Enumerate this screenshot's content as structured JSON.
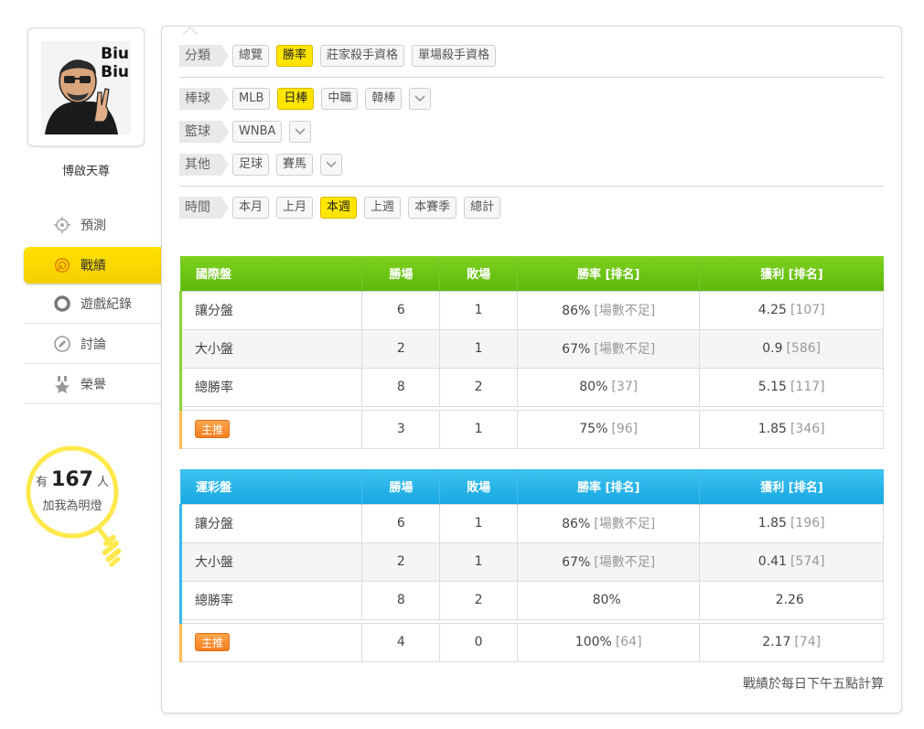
{
  "profile": {
    "avatar_caption": [
      "Biu",
      "Biu"
    ],
    "username": "博啟天尊"
  },
  "side_nav": [
    {
      "label": "預測",
      "icon": "crosshair-icon"
    },
    {
      "label": "戰績",
      "icon": "target-icon",
      "active": true
    },
    {
      "label": "遊戲紀錄",
      "icon": "circle-icon"
    },
    {
      "label": "討論",
      "icon": "pencil-bubble-icon"
    },
    {
      "label": "榮譽",
      "icon": "medal-star-icon"
    }
  ],
  "fans": {
    "prefix": "有",
    "count": "167",
    "suffix": "人",
    "line2": "加我為明燈"
  },
  "filters": {
    "category": {
      "label": "分類",
      "options": [
        "總覽",
        "勝率",
        "莊家殺手資格",
        "單場殺手資格"
      ],
      "selected": "勝率"
    },
    "baseball": {
      "label": "棒球",
      "options": [
        "MLB",
        "日棒",
        "中職",
        "韓棒"
      ],
      "selected": "日棒"
    },
    "basketball": {
      "label": "籃球",
      "options": [
        "WNBA"
      ],
      "selected": ""
    },
    "other": {
      "label": "其他",
      "options": [
        "足球",
        "賽馬"
      ],
      "selected": ""
    },
    "time": {
      "label": "時間",
      "options": [
        "本月",
        "上月",
        "本週",
        "上週",
        "本賽季",
        "總計"
      ],
      "selected": "本週"
    }
  },
  "international": {
    "headers": [
      "國際盤",
      "勝場",
      "敗場",
      "勝率 [排名]",
      "獲利 [排名]"
    ],
    "rows": [
      {
        "name": "讓分盤",
        "win": "6",
        "lose": "1",
        "rate": "86%",
        "rate_rank": "[場數不足]",
        "profit": "4.25",
        "profit_rank": "[107]"
      },
      {
        "name": "大小盤",
        "win": "2",
        "lose": "1",
        "rate": "67%",
        "rate_rank": "[場數不足]",
        "profit": "0.9",
        "profit_rank": "[586]"
      },
      {
        "name": "總勝率",
        "win": "8",
        "lose": "2",
        "rate": "80%",
        "rate_rank": "[37]",
        "profit": "5.15",
        "profit_rank": "[117]"
      }
    ],
    "tip": {
      "name": "主推",
      "win": "3",
      "lose": "1",
      "rate": "75%",
      "rate_rank": "[96]",
      "profit": "1.85",
      "profit_rank": "[346]"
    }
  },
  "lottery": {
    "headers": [
      "運彩盤",
      "勝場",
      "敗場",
      "勝率 [排名]",
      "獲利 [排名]"
    ],
    "rows": [
      {
        "name": "讓分盤",
        "win": "6",
        "lose": "1",
        "rate": "86%",
        "rate_rank": "[場數不足]",
        "profit": "1.85",
        "profit_rank": "[196]"
      },
      {
        "name": "大小盤",
        "win": "2",
        "lose": "1",
        "rate": "67%",
        "rate_rank": "[場數不足]",
        "profit": "0.41",
        "profit_rank": "[574]"
      },
      {
        "name": "總勝率",
        "win": "8",
        "lose": "2",
        "rate": "80%",
        "rate_rank": "",
        "profit": "2.26",
        "profit_rank": ""
      }
    ],
    "tip": {
      "name": "主推",
      "win": "4",
      "lose": "0",
      "rate": "100%",
      "rate_rank": "[64]",
      "profit": "2.17",
      "profit_rank": "[74]"
    }
  },
  "footnote": "戰績於每日下午五點計算",
  "colors": {
    "accent_yellow": "#ffe500",
    "intl_green": "#6cc414",
    "lottery_blue": "#22b0e6",
    "tip_orange": "#f58a2a"
  }
}
